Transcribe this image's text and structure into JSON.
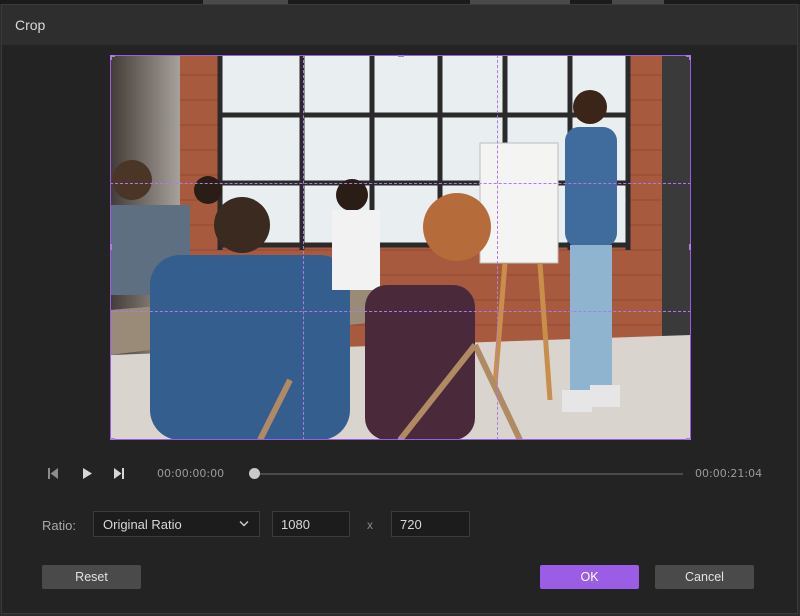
{
  "dialog": {
    "title": "Crop"
  },
  "playback": {
    "current_time": "00:00:00:00",
    "total_time": "00:00:21:04",
    "progress": 0.0
  },
  "ratio": {
    "label": "Ratio:",
    "selected": "Original Ratio",
    "width": "1080",
    "separator": "x",
    "height": "720"
  },
  "buttons": {
    "reset": "Reset",
    "ok": "OK",
    "cancel": "Cancel"
  },
  "colors": {
    "accent": "#9b5de5",
    "background": "#232323",
    "titlebar": "#2e2e2e"
  },
  "icons": [
    "skip-back-icon",
    "play-icon",
    "skip-forward-icon",
    "chevron-down-icon"
  ]
}
